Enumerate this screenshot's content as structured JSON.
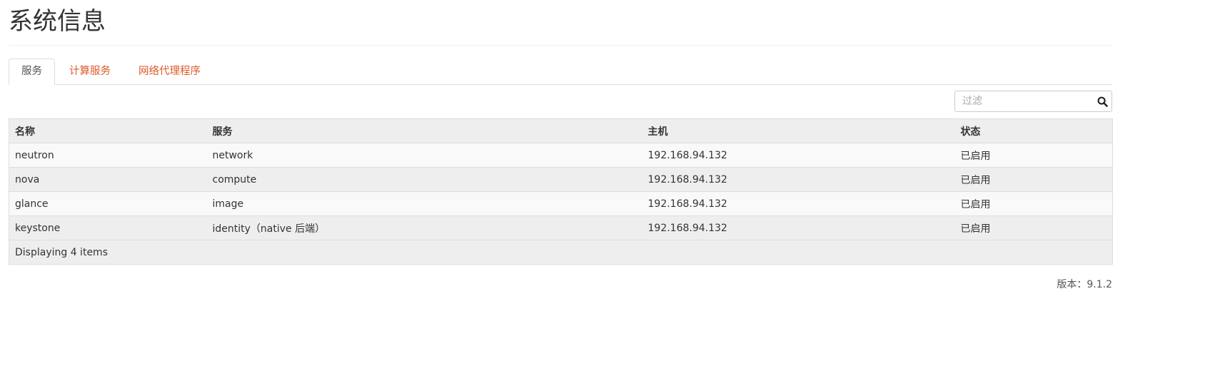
{
  "page": {
    "title": "系统信息"
  },
  "tabs": [
    {
      "label": "服务",
      "active": true
    },
    {
      "label": "计算服务",
      "active": false
    },
    {
      "label": "网络代理程序",
      "active": false
    }
  ],
  "filter": {
    "placeholder": "过滤",
    "value": "",
    "icon": "search-icon"
  },
  "table": {
    "headers": [
      "名称",
      "服务",
      "主机",
      "状态"
    ],
    "rows": [
      {
        "name": "neutron",
        "service": "network",
        "host": "192.168.94.132",
        "status": "已启用"
      },
      {
        "name": "nova",
        "service": "compute",
        "host": "192.168.94.132",
        "status": "已启用"
      },
      {
        "name": "glance",
        "service": "image",
        "host": "192.168.94.132",
        "status": "已启用"
      },
      {
        "name": "keystone",
        "service": "identity（native 后端）",
        "host": "192.168.94.132",
        "status": "已启用"
      }
    ],
    "footer": "Displaying 4 items"
  },
  "version": {
    "text": "版本：9.1.2"
  },
  "colors": {
    "tab_link": "#e05a2a",
    "header_bg": "#eeeeee",
    "row_stripe": "#f9f9f9",
    "border": "#dddddd"
  }
}
